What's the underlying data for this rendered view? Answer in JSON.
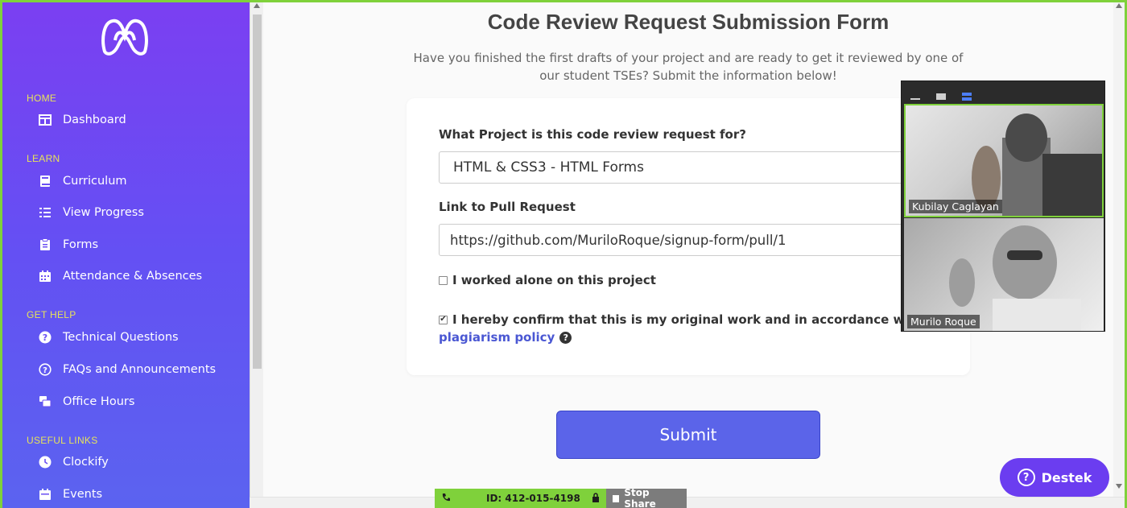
{
  "sidebar": {
    "sections": [
      {
        "title": "HOME",
        "items": [
          {
            "label": "Dashboard",
            "icon": "dashboard-icon"
          }
        ]
      },
      {
        "title": "LEARN",
        "items": [
          {
            "label": "Curriculum",
            "icon": "book-icon"
          },
          {
            "label": "View Progress",
            "icon": "list-icon"
          },
          {
            "label": "Forms",
            "icon": "clipboard-icon"
          },
          {
            "label": "Attendance & Absences",
            "icon": "calendar-icon"
          }
        ]
      },
      {
        "title": "GET HELP",
        "items": [
          {
            "label": "Technical Questions",
            "icon": "question-icon"
          },
          {
            "label": "FAQs and Announcements",
            "icon": "question-circle-icon"
          },
          {
            "label": "Office Hours",
            "icon": "people-icon"
          }
        ]
      },
      {
        "title": "USEFUL LINKS",
        "items": [
          {
            "label": "Clockify",
            "icon": "clock-icon"
          },
          {
            "label": "Events",
            "icon": "calendar-icon"
          }
        ]
      }
    ]
  },
  "main": {
    "title": "Code Review Request Submission Form",
    "subtitle_line1": "Have you finished the first drafts of your project and are ready to get it reviewed by one of",
    "subtitle_line2": "our student TSEs? Submit the information below!",
    "project_label": "What Project is this code review request for?",
    "project_value": "HTML & CSS3 - HTML Forms",
    "pr_label": "Link to Pull Request",
    "pr_value": "https://github.com/MuriloRoque/signup-form/pull/1",
    "alone_label": "I worked alone on this project",
    "alone_checked": false,
    "confirm_label": "I hereby confirm that this is my original work and in accordance with",
    "confirm_checked": true,
    "policy_link": "plagiarism policy",
    "submit_label": "Submit"
  },
  "video": {
    "participants": [
      {
        "name": "Kubilay Caglayan",
        "active": true
      },
      {
        "name": "Murilo Roque",
        "active": false
      }
    ]
  },
  "help_button": {
    "label": "Destek"
  },
  "share_bar": {
    "id_text": "ID: 412-015-4198",
    "stop_label": "Stop Share"
  },
  "colors": {
    "sidebar_top": "#7b3ff2",
    "sidebar_bottom": "#5b63f0",
    "section_title": "#e7e35a",
    "submit": "#5b64e9",
    "link": "#4a57d3",
    "share_green": "#7fd13b"
  }
}
